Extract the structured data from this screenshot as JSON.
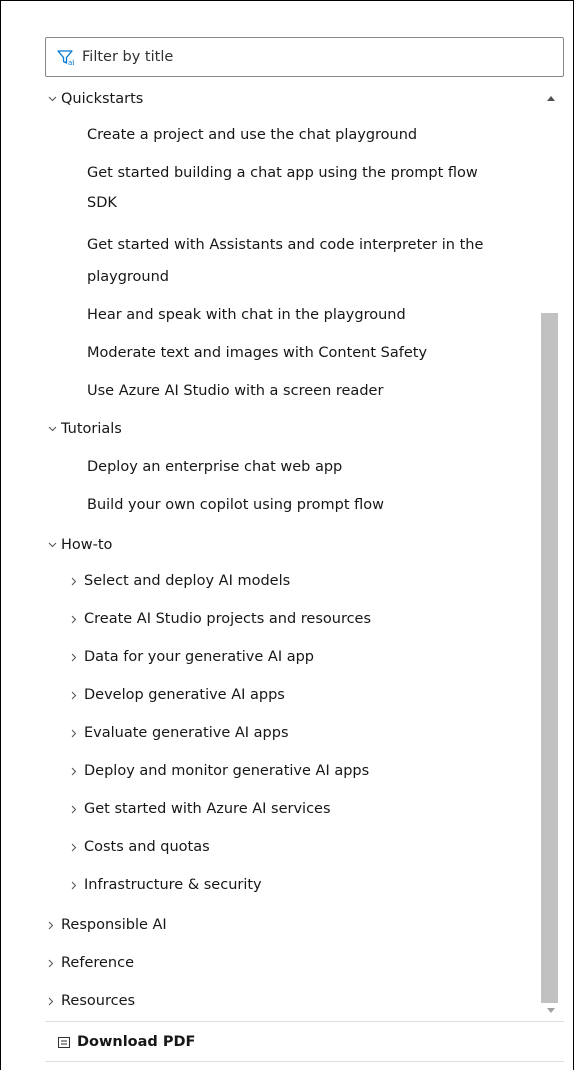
{
  "filter": {
    "placeholder": "Filter by title",
    "value": ""
  },
  "tree": {
    "items": [
      {
        "label": "Quickstarts",
        "chevron": "down",
        "expanded": true
      },
      {
        "label": "Create a project and use the chat playground"
      },
      {
        "label": "Get started building a chat app using the prompt flow",
        "label2": "SDK"
      },
      {
        "label": "Get started with Assistants and code interpreter in the",
        "label2": "playground"
      },
      {
        "label": "Hear and speak with chat in the playground"
      },
      {
        "label": "Moderate text and images with Content Safety"
      },
      {
        "label": "Use Azure AI Studio with a screen reader"
      },
      {
        "label": "Tutorials",
        "chevron": "down",
        "expanded": true
      },
      {
        "label": "Deploy an enterprise chat web app"
      },
      {
        "label": "Build your own copilot using prompt flow"
      },
      {
        "label": "How-to",
        "chevron": "down",
        "expanded": true
      },
      {
        "label": "Select and deploy AI models",
        "chevron": "right"
      },
      {
        "label": "Create AI Studio projects and resources",
        "chevron": "right"
      },
      {
        "label": "Data for your generative AI app",
        "chevron": "right"
      },
      {
        "label": "Develop generative AI apps",
        "chevron": "right"
      },
      {
        "label": "Evaluate generative AI apps",
        "chevron": "right"
      },
      {
        "label": "Deploy and monitor generative AI apps",
        "chevron": "right"
      },
      {
        "label": "Get started with Azure AI services",
        "chevron": "right"
      },
      {
        "label": "Costs and quotas",
        "chevron": "right"
      },
      {
        "label": "Infrastructure & security",
        "chevron": "right"
      },
      {
        "label": "Responsible AI",
        "chevron": "right"
      },
      {
        "label": "Reference",
        "chevron": "right"
      },
      {
        "label": "Resources",
        "chevron": "right"
      }
    ]
  },
  "footer": {
    "download_label": "Download PDF"
  },
  "colors": {
    "accent": "#0078d4",
    "text": "#171717",
    "scroll_thumb": "#c1c1c1"
  }
}
